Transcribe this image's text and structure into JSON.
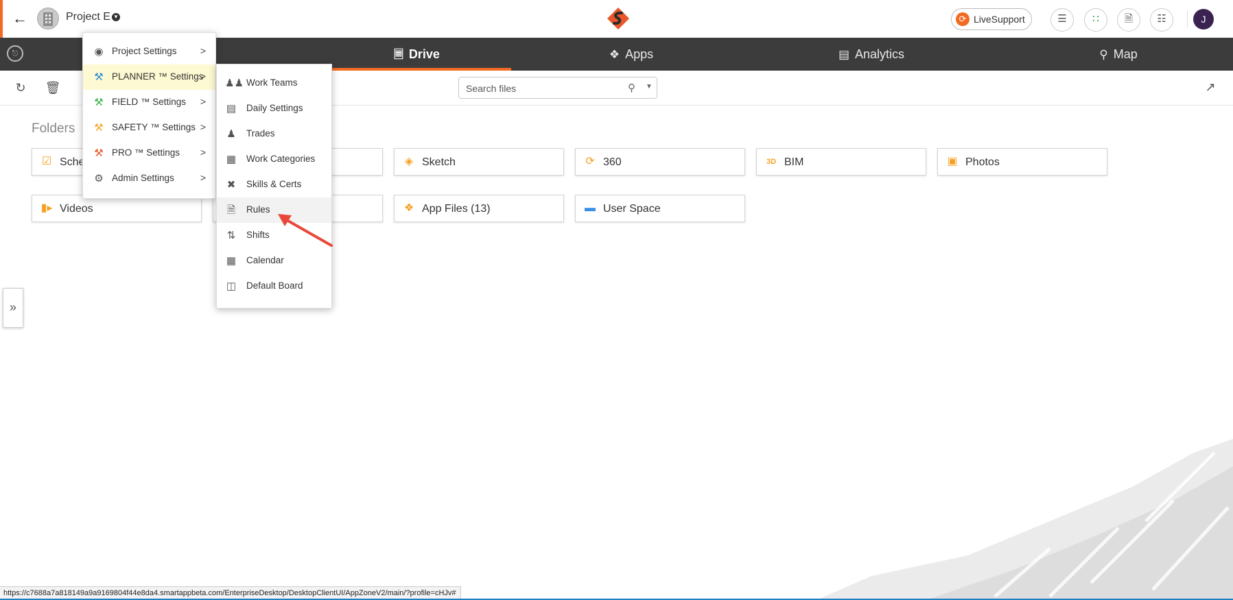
{
  "header": {
    "project_name": "Project E",
    "livesupport_label": "LiveSupport",
    "user_initial": "J"
  },
  "nav": {
    "tabs": [
      {
        "label": "Drive",
        "icon": "drive-icon",
        "active": true
      },
      {
        "label": "Apps",
        "icon": "apps-icon"
      },
      {
        "label": "Analytics",
        "icon": "analytics-icon"
      },
      {
        "label": "Map",
        "icon": "map-pin-icon"
      }
    ]
  },
  "search": {
    "placeholder": "Search files"
  },
  "folders": {
    "title": "Folders",
    "items": [
      {
        "label": "Sche",
        "icon": "calendar-icon"
      },
      {
        "label": "",
        "icon": ""
      },
      {
        "label": "Sketch",
        "icon": "sketch-icon"
      },
      {
        "label": "360",
        "icon": "360-icon"
      },
      {
        "label": "BIM",
        "icon": "bim-icon"
      },
      {
        "label": "Photos",
        "icon": "photos-icon"
      },
      {
        "label": "Videos",
        "icon": "video-icon"
      },
      {
        "label": "",
        "icon": ""
      },
      {
        "label": "App Files (13)",
        "icon": "app-files-icon"
      },
      {
        "label": "User Space",
        "icon": "user-space-icon"
      }
    ]
  },
  "settings_menu": {
    "items": [
      {
        "label": "Project Settings",
        "icon": "camera-icon",
        "color": "#555555"
      },
      {
        "label": "PLANNER ™ Settings",
        "icon": "hammer-icon",
        "color": "#2b8fd6",
        "highlighted": true
      },
      {
        "label": "FIELD ™ Settings",
        "icon": "hammer-icon",
        "color": "#3db54a"
      },
      {
        "label": "SAFETY ™ Settings",
        "icon": "hammer-icon",
        "color": "#f5a623"
      },
      {
        "label": "PRO ™ Settings",
        "icon": "hammer-icon",
        "color": "#e8562a"
      },
      {
        "label": "Admin Settings",
        "icon": "admin-user-icon",
        "color": "#555555"
      }
    ]
  },
  "planner_submenu": {
    "items": [
      {
        "label": "Work Teams",
        "icon": "work-teams-icon"
      },
      {
        "label": "Daily Settings",
        "icon": "daily-settings-icon"
      },
      {
        "label": "Trades",
        "icon": "worker-icon"
      },
      {
        "label": "Work Categories",
        "icon": "categories-icon"
      },
      {
        "label": "Skills & Certs",
        "icon": "tools-icon"
      },
      {
        "label": "Rules",
        "icon": "rules-document-icon",
        "hovered": true
      },
      {
        "label": "Shifts",
        "icon": "shifts-icon"
      },
      {
        "label": "Calendar",
        "icon": "calendar-grid-icon"
      },
      {
        "label": "Default Board",
        "icon": "board-icon"
      }
    ]
  },
  "status_url": "https://c7688a7a818149a9a9169804f44e8da4.smartappbeta.com/EnterpriseDesktop/DesktopClientUI/AppZoneV2/main/?profile=cHJv#",
  "colors": {
    "accent": "#f26a22",
    "navbar": "#3c3c3c",
    "folder_icon": "#f5a123",
    "highlight": "#fdf9d2",
    "annotation_arrow": "#e8473a"
  }
}
